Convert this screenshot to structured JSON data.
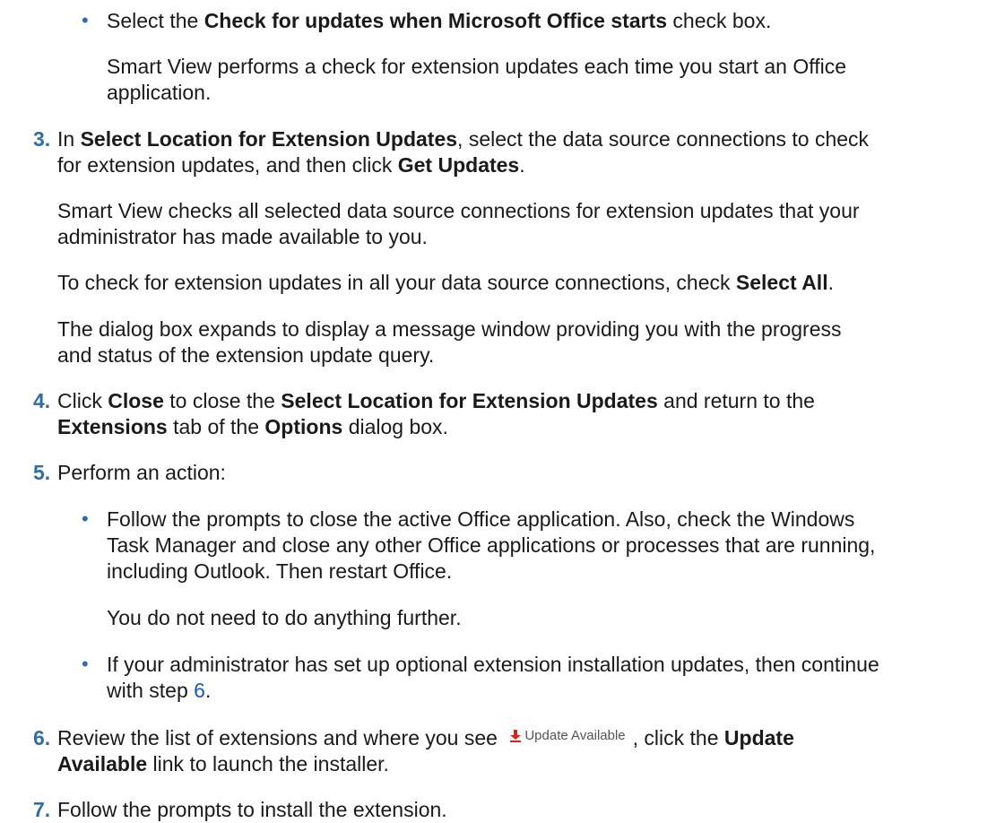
{
  "bullet_1": {
    "pre": "Select the ",
    "bold": "Check for updates when Microsoft Office starts",
    "post": " check box."
  },
  "bullet_1_result": {
    "line1": "Smart View performs a check for extension updates each time you start an Office",
    "line2": "application."
  },
  "step_3": {
    "number": "3.",
    "line1_pre": "In ",
    "line1_bold": "Select Location for Extension Updates",
    "line1_post": ", select the data source connections to check",
    "line2_pre": "for extension updates, and then click ",
    "line2_bold": "Get Updates",
    "line2_post": ".",
    "para1_line1": "Smart View checks all selected data source connections for extension updates that your",
    "para1_line2": "administrator has made available to you.",
    "para2_pre": "To check for extension updates in all your data source connections, check ",
    "para2_bold": "Select All",
    "para2_post": ".",
    "para3_line1": "The dialog box expands to display a message window providing you with the progress",
    "para3_line2": "and status of the extension update query."
  },
  "step_4": {
    "number": "4.",
    "line1_pre": "Click ",
    "line1_bold1": "Close",
    "line1_mid": " to close the ",
    "line1_bold2": "Select Location for Extension Updates",
    "line1_post": " and return to the",
    "line2_bold1": "Extensions",
    "line2_mid": " tab of the ",
    "line2_bold2": "Options",
    "line2_post": " dialog box."
  },
  "step_5": {
    "number": "5.",
    "text": "Perform an action:",
    "bullet_a": {
      "line1": "Follow the prompts to close the active Office application. Also, check the Windows",
      "line2": "Task Manager and close any other Office applications or processes that are running,",
      "line3": "including Outlook. Then restart Office.",
      "result": "You do not need to do anything further."
    },
    "bullet_b": {
      "line1": "If your administrator has set up optional extension installation updates, then continue",
      "line2_pre": "with step ",
      "line2_link": "6",
      "line2_post": "."
    }
  },
  "step_6": {
    "number": "6.",
    "line1_pre": "Review the list of extensions and where you see ",
    "icon_label": "Update Available",
    "line1_mid": ", click the ",
    "line1_bold": "Update",
    "line2_bold": "Available",
    "line2_post": " link to launch the installer."
  },
  "step_7": {
    "number": "7.",
    "text": "Follow the prompts to install the extension."
  },
  "colors": {
    "step_number": "#2f6ca8",
    "link": "#1a56c8",
    "text": "#1a1a1a",
    "download_icon": "#d9241c"
  },
  "icons": {
    "bullet": "bullet-dot",
    "update_available": "download-arrow-icon"
  }
}
